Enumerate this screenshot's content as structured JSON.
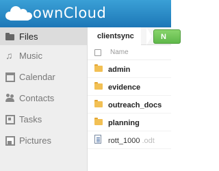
{
  "header": {
    "logo_text": "ownCloud",
    "brand_color": "#1d77b7"
  },
  "sidebar": {
    "items": [
      {
        "label": "Files",
        "icon": "folder-icon",
        "active": true
      },
      {
        "label": "Music",
        "icon": "music-icon",
        "active": false
      },
      {
        "label": "Calendar",
        "icon": "calendar-icon",
        "active": false
      },
      {
        "label": "Contacts",
        "icon": "contacts-icon",
        "active": false
      },
      {
        "label": "Tasks",
        "icon": "tasks-icon",
        "active": false
      },
      {
        "label": "Pictures",
        "icon": "pictures-icon",
        "active": false
      }
    ]
  },
  "breadcrumb": {
    "current": "clientsync"
  },
  "toolbar": {
    "new_label": "N",
    "new_color": "#5fb84a"
  },
  "file_list": {
    "name_header": "Name",
    "rows": [
      {
        "name": "admin",
        "type": "folder"
      },
      {
        "name": "evidence",
        "type": "folder"
      },
      {
        "name": "outreach_docs",
        "type": "folder"
      },
      {
        "name": "planning",
        "type": "folder"
      },
      {
        "name": "rott_1000",
        "ext": ".odt",
        "type": "file"
      }
    ]
  }
}
